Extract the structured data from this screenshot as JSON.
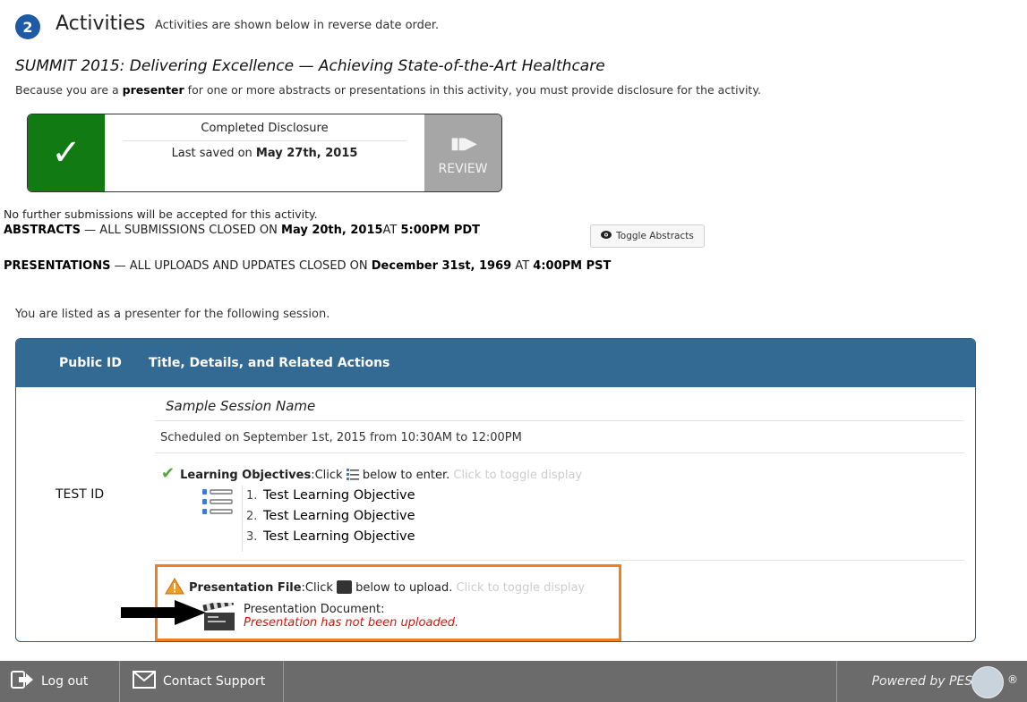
{
  "header": {
    "step_number": "2",
    "title": "Activities",
    "subtitle": "Activities are shown below in reverse date order."
  },
  "activity": {
    "title": "SUMMIT 2015: Delivering Excellence — Achieving State-of-the-Art Healthcare",
    "presenter_pre": "Because you are a ",
    "presenter_bold": "presenter",
    "presenter_post": " for one or more abstracts or presentations in this activity, you must provide disclosure for the activity."
  },
  "disclosure": {
    "status": "Completed Disclosure",
    "saved_pre": "Last saved on ",
    "saved_date": "May 27th, 2015",
    "review_label": "REVIEW"
  },
  "notices": {
    "no_further": "No further submissions will be accepted for this activity.",
    "abstracts_pre": "ABSTRACTS",
    "abstracts_mid": " — ALL SUBMISSIONS CLOSED ON ",
    "abstracts_date": "May 20th, 2015",
    "abstracts_at": "AT ",
    "abstracts_time": "5:00PM PDT",
    "toggle_abstracts": "Toggle Abstracts",
    "presentations_pre": "PRESENTATIONS",
    "presentations_mid": " — ALL UPLOADS AND UPDATES CLOSED ON ",
    "presentations_date": "December 31st, 1969",
    "presentations_at": " AT ",
    "presentations_time": "4:00PM PST",
    "listed": "You are listed as a presenter for the following session."
  },
  "table": {
    "col_id": "Public ID",
    "col_title": "Title, Details, and Related Actions",
    "row": {
      "public_id": "TEST ID",
      "session_name": "Sample Session Name",
      "scheduled": "Scheduled on September 1st, 2015 from 10:30AM to 12:00PM",
      "lo_label": "Learning Objectives",
      "lo_pre": ":Click ",
      "lo_post": " below to enter.",
      "lo_toggle": " Click to toggle display",
      "objectives": [
        {
          "num": "1.",
          "text": "Test Learning Objective"
        },
        {
          "num": "2.",
          "text": "Test Learning Objective"
        },
        {
          "num": "3.",
          "text": "Test Learning Objective"
        }
      ],
      "pf_label": "Presentation File",
      "pf_pre": ":Click ",
      "pf_post": " below to upload.",
      "pf_toggle": " Click to toggle display",
      "doc_label": "Presentation Document:",
      "doc_status": "Presentation has not been uploaded."
    }
  },
  "footer": {
    "logout": "Log out",
    "contact": "Contact Support",
    "powered": "Powered by PESG",
    "reg": "®"
  },
  "colors": {
    "accent": "#1f5aa6",
    "table_header": "#336a94",
    "success": "#127a12",
    "highlight": "#f07f21",
    "error": "#d51414",
    "footer": "#6b6b6b"
  }
}
